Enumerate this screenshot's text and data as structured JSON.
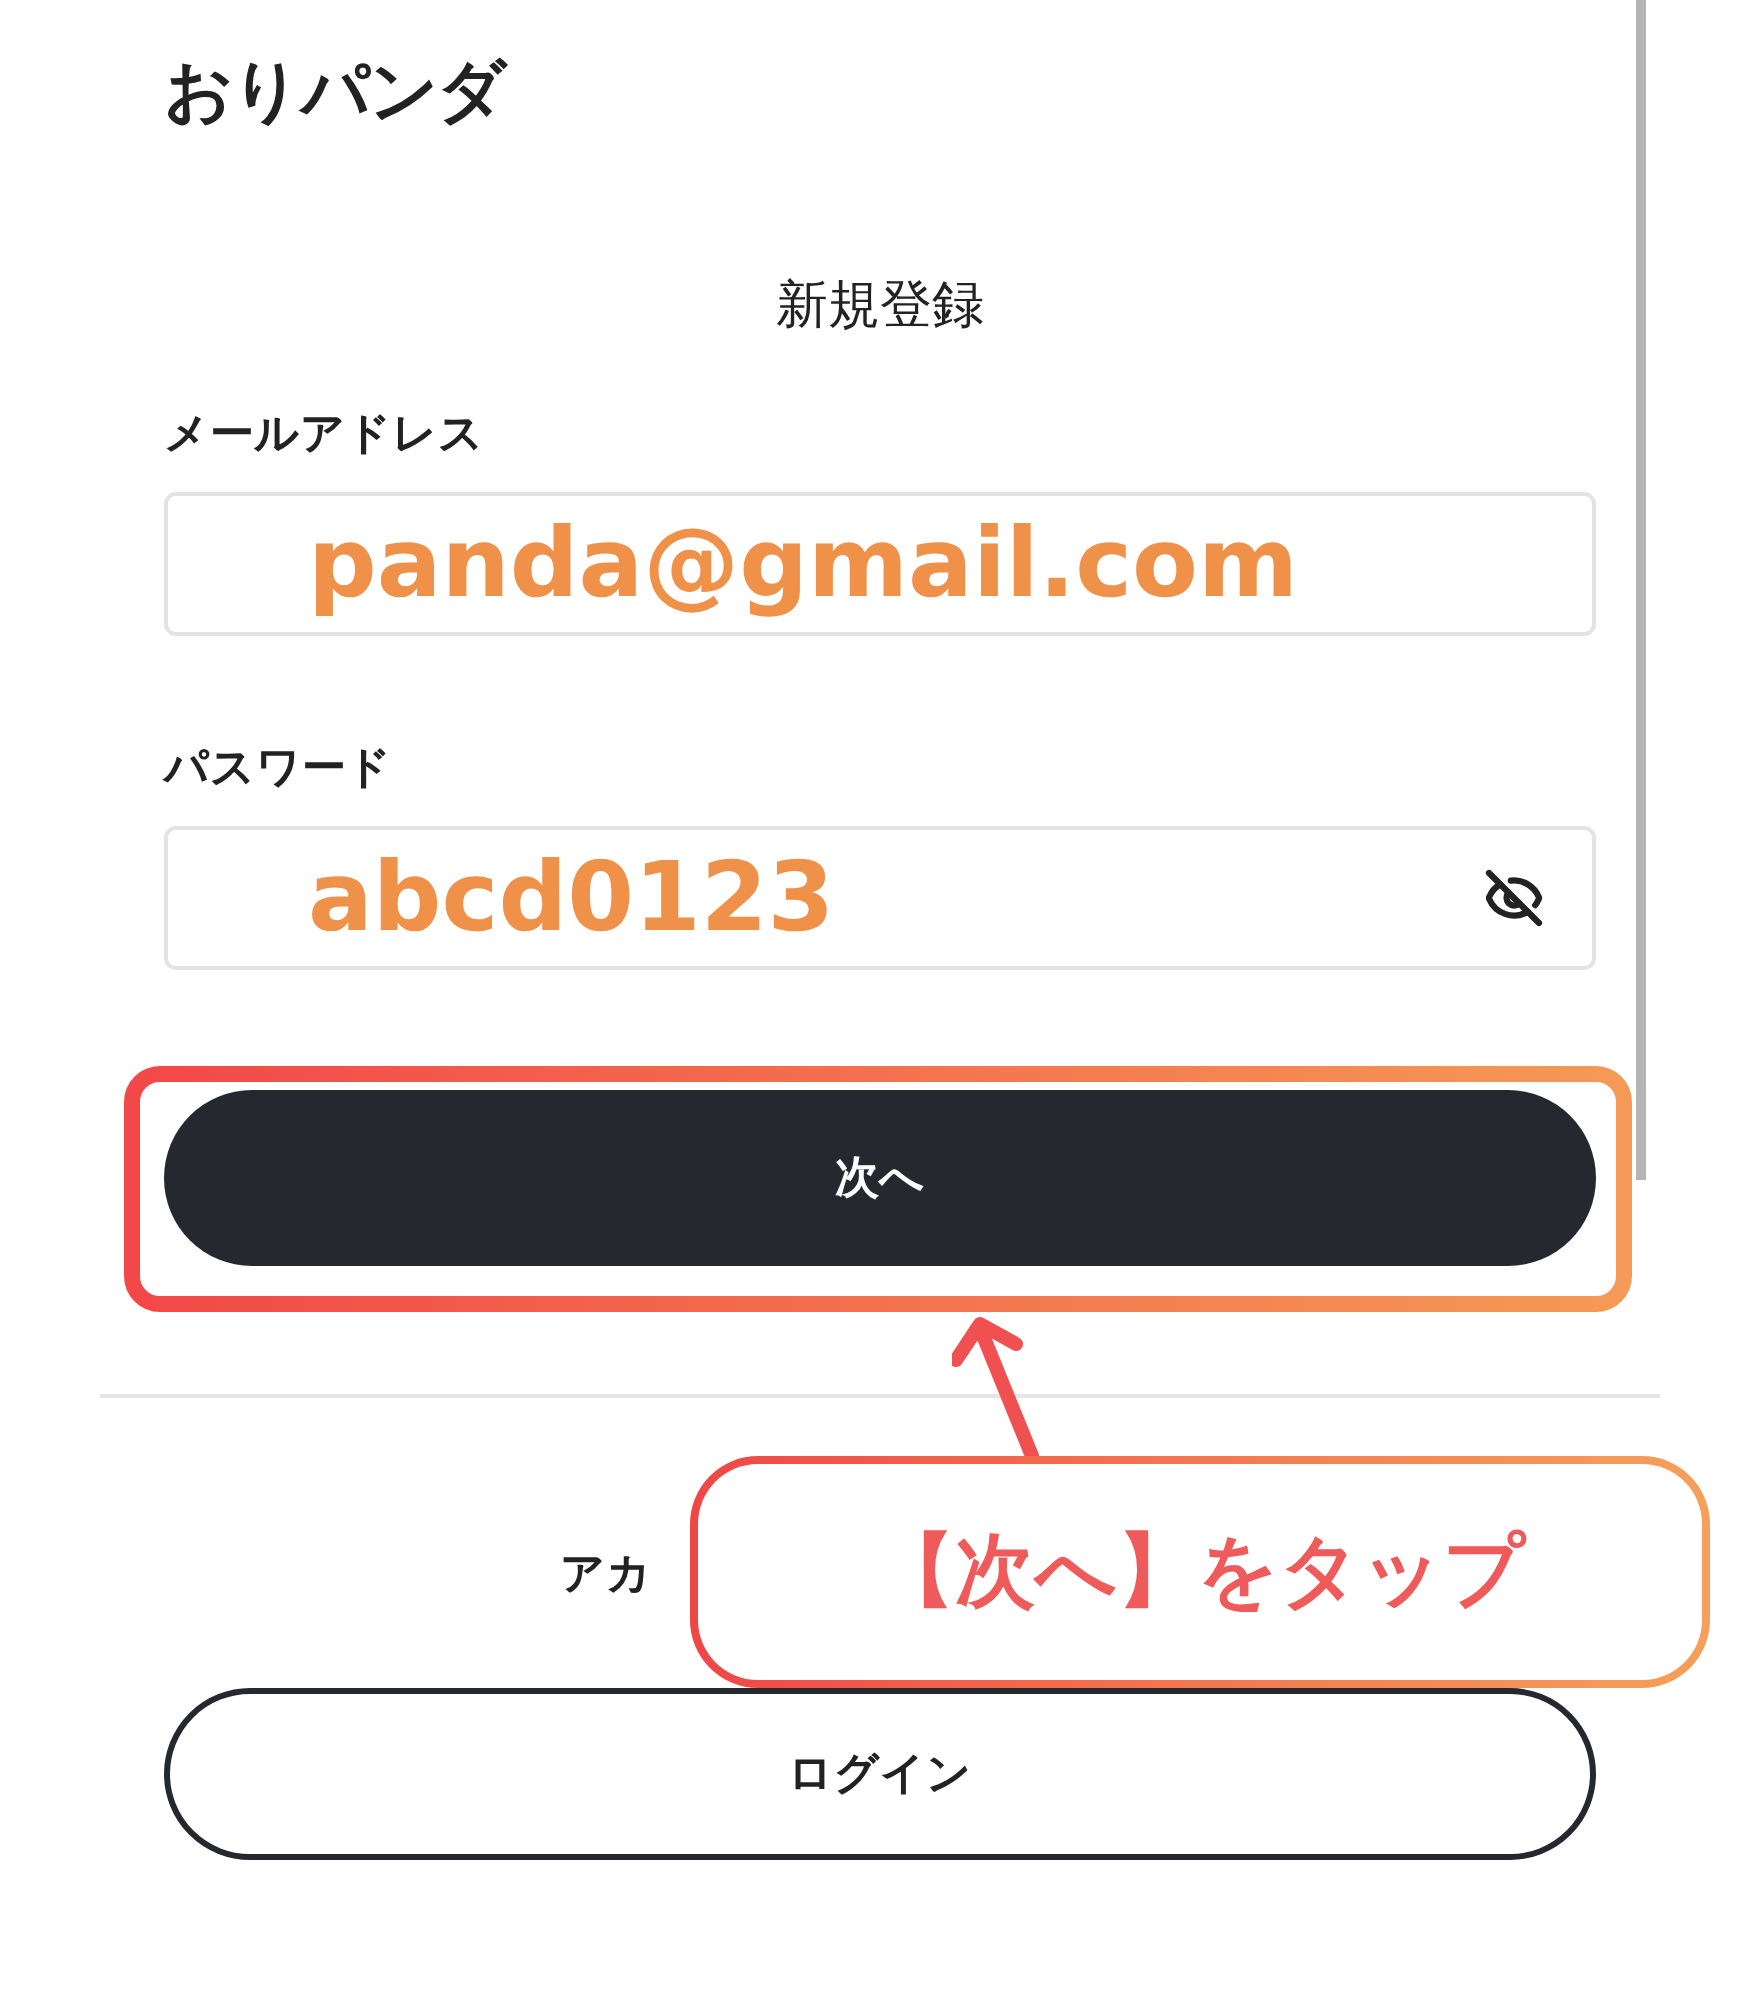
{
  "logo": "おりパンダ",
  "title": "新規登録",
  "fields": [
    {
      "label": "メールアドレス",
      "value": "panda@gmail.com",
      "kind": "text"
    },
    {
      "label": "パスワード",
      "value": "abcd0123",
      "kind": "password"
    }
  ],
  "next_button": "次へ",
  "account_prompt": "アカ",
  "login_button": "ログイン",
  "annotation": {
    "text": "【次へ】をタップ"
  }
}
